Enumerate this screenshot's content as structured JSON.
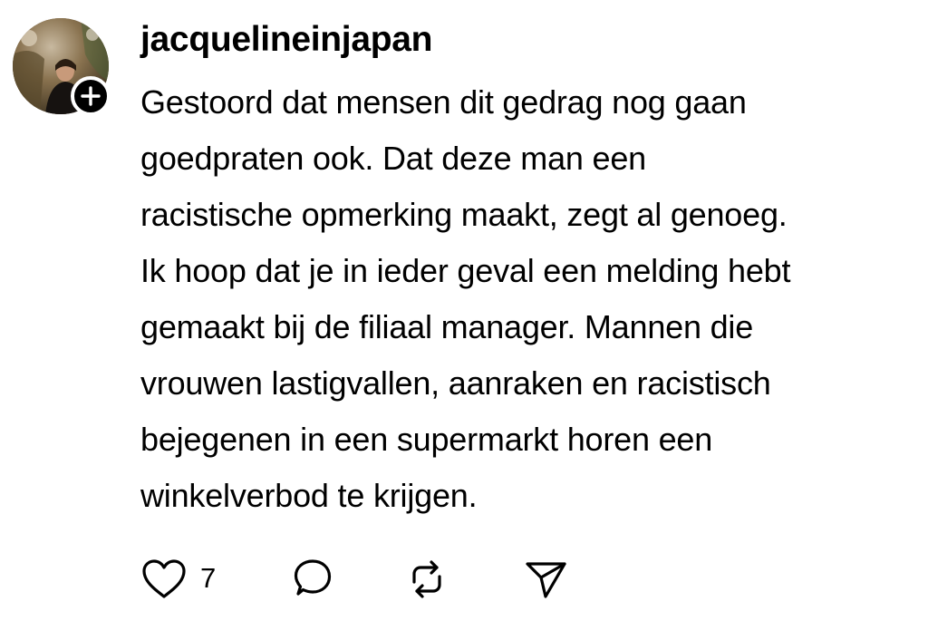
{
  "post": {
    "author": {
      "username": "jacquelineinjapan",
      "avatar_icon": "profile-photo",
      "follow_icon": "plus-icon"
    },
    "text": "Gestoord dat mensen dit gedrag nog gaan\ngoedpraten ook. Dat deze man een\nracistische opmerking maakt, zegt al genoeg.\nIk hoop dat je in ieder geval een melding hebt\ngemaakt bij de filiaal manager. Mannen die\nvrouwen lastigvallen, aanraken en racistisch\nbejegenen in een supermarkt horen een\nwinkelverbod te krijgen.",
    "actions": {
      "like": {
        "icon": "heart-icon",
        "count": "7"
      },
      "reply": {
        "icon": "comment-icon"
      },
      "repost": {
        "icon": "repost-icon"
      },
      "share": {
        "icon": "send-icon"
      }
    }
  },
  "colors": {
    "text": "#000000",
    "background": "#ffffff"
  }
}
